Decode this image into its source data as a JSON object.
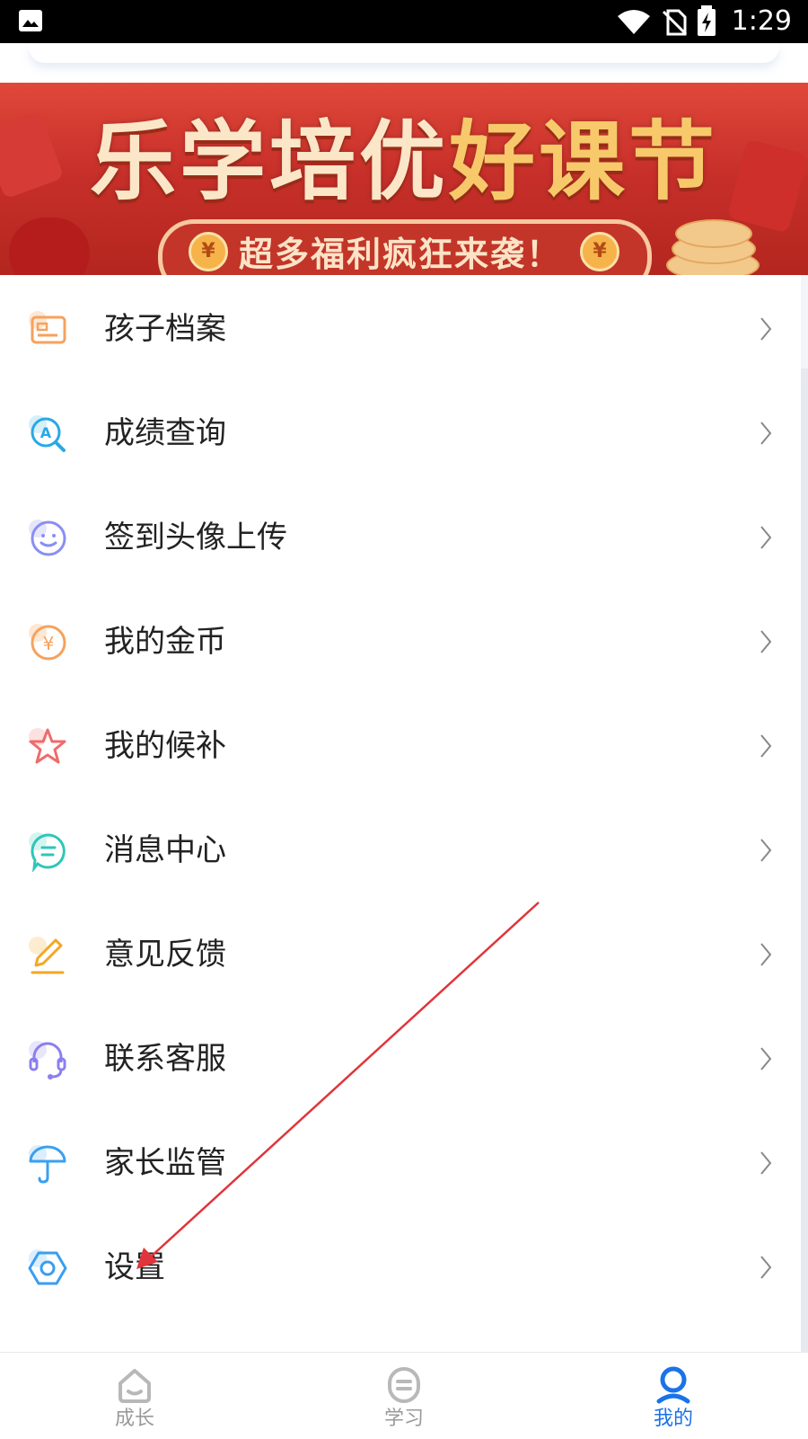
{
  "status_bar": {
    "time": "1:29"
  },
  "banner": {
    "title_part1": "乐学培优",
    "title_part2": "好课节",
    "subtitle": "超多福利疯狂来袭！",
    "coin_symbol": "¥"
  },
  "menu": {
    "items": [
      {
        "label": "孩子档案",
        "icon": "profile-card-icon",
        "color": "#f5a25d"
      },
      {
        "label": "成绩查询",
        "icon": "grade-search-icon",
        "color": "#29a8e6"
      },
      {
        "label": "签到头像上传",
        "icon": "smiley-icon",
        "color": "#8a8ff0"
      },
      {
        "label": "我的金币",
        "icon": "coin-icon",
        "color": "#f5a25d"
      },
      {
        "label": "我的候补",
        "icon": "star-icon",
        "color": "#f06b6b"
      },
      {
        "label": "消息中心",
        "icon": "message-icon",
        "color": "#2ec6b8"
      },
      {
        "label": "意见反馈",
        "icon": "pencil-icon",
        "color": "#f5a623"
      },
      {
        "label": "联系客服",
        "icon": "headset-icon",
        "color": "#8a7ff0"
      },
      {
        "label": "家长监管",
        "icon": "umbrella-icon",
        "color": "#3aa0f0"
      },
      {
        "label": "设置",
        "icon": "gear-icon",
        "color": "#3a9ef0"
      }
    ]
  },
  "bottom_nav": {
    "tabs": [
      {
        "label": "成长",
        "icon": "home-icon",
        "active": false
      },
      {
        "label": "学习",
        "icon": "study-icon",
        "active": false
      },
      {
        "label": "我的",
        "icon": "user-icon",
        "active": true
      }
    ],
    "active_color": "#1a73e8",
    "inactive_color": "#9a9a9a"
  },
  "annotation": {
    "color": "#e0353a"
  }
}
